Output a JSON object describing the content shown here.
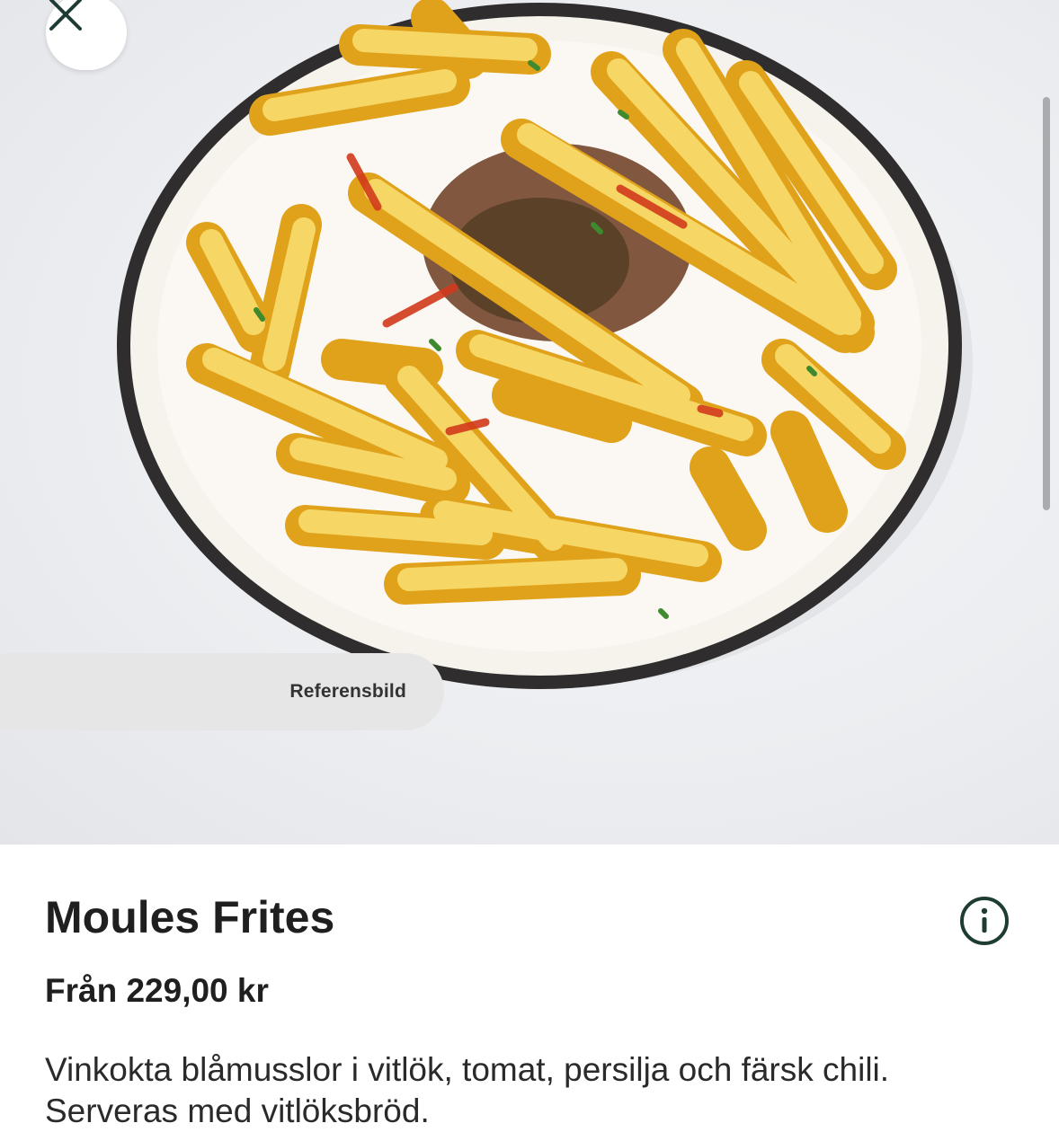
{
  "image": {
    "badge_label": "Referensbild"
  },
  "product": {
    "title": "Moules Frites",
    "price": "Från 229,00 kr",
    "description": "Vinkokta blåmusslor i vitlök, tomat, persilja och färsk chili. Serveras med vitlöksbröd."
  },
  "icons": {
    "close": "close-icon",
    "info": "info-icon"
  },
  "colors": {
    "accent": "#1e3b34",
    "hero_background": "#eceef1",
    "badge_background": "#e6e6e7"
  }
}
